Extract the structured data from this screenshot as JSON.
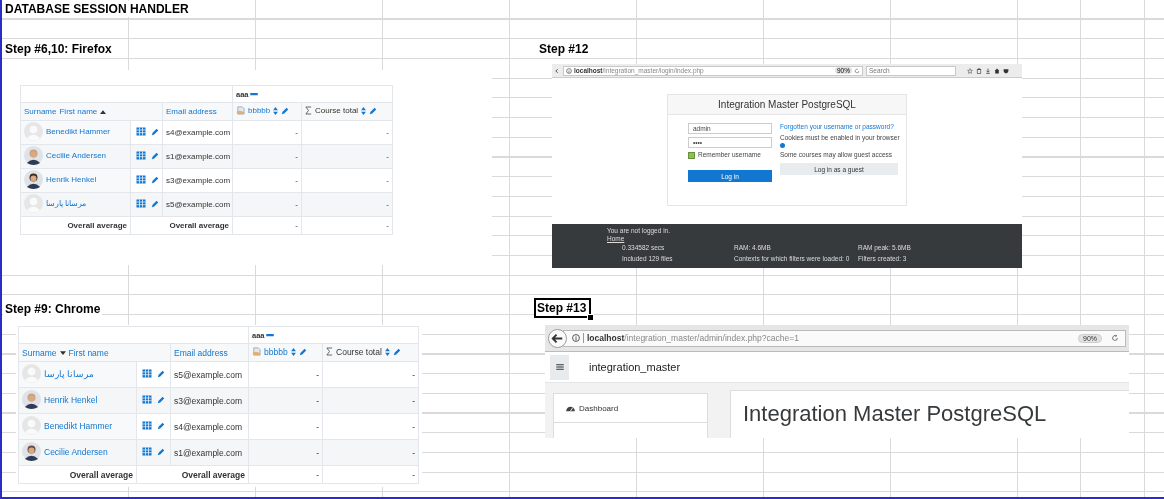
{
  "sheet_title": "DATABASE SESSION HANDLER",
  "sections": [
    {
      "kind": "grades",
      "heading": "Step #6,10: Firefox",
      "selected": false,
      "category": "aaa",
      "name_headers": [
        {
          "label": "Surname",
          "sorted": false
        },
        {
          "label": "First name",
          "sorted": true,
          "descending": false
        }
      ],
      "email_header": "Email address",
      "grade_item": "bbbbb",
      "total_header": "Course total",
      "rows": [
        {
          "name": "Benedikt Hammer",
          "has_photo": false,
          "email": "s4@example.com",
          "grade": "-",
          "total": "-"
        },
        {
          "name": "Cecilie Andersen",
          "has_photo": true,
          "email": "s1@example.com",
          "grade": "-",
          "total": "-"
        },
        {
          "name": "Henrik Henkel",
          "has_photo": true,
          "email": "s3@example.com",
          "grade": "-",
          "total": "-"
        },
        {
          "name": "مرسانا پارسا",
          "has_photo": false,
          "email": "s5@example.com",
          "grade": "-",
          "total": "-"
        }
      ],
      "average": {
        "label_1": "Overall average",
        "label_2": "Overall average",
        "grade": "-",
        "total": "-"
      }
    },
    {
      "kind": "login",
      "heading": "Step #12",
      "selected": false,
      "url_host": "localhost",
      "url_path": "/integration_master/login/index.php",
      "zoom": "90%",
      "search_placeholder": "Search",
      "site_title": "Integration Master PostgreSQL",
      "username": "admin",
      "password": "••••",
      "remember": {
        "label": "Remember username",
        "checked": true
      },
      "forgot_link": "Forgotten your username or password?",
      "cookies_note": "Cookies must be enabled in your browser",
      "guest_note": "Some courses may allow guest access",
      "guest_button": "Log in as a guest",
      "login_button": "Log in",
      "footer": {
        "status": "You are not logged in.",
        "home_link": "Home",
        "stats": [
          "0.334582 secs",
          "RAM: 4.6MB",
          "RAM peak: 5.6MB",
          "Included 129 files",
          "Contexts for which filters were loaded: 0",
          "Filters created: 3"
        ]
      }
    },
    {
      "kind": "grades",
      "heading": "Step #9: Chrome",
      "selected": false,
      "category": "aaa",
      "name_headers": [
        {
          "label": "Surname",
          "sorted": true,
          "descending": true
        },
        {
          "label": "First name",
          "sorted": false
        }
      ],
      "email_header": "Email address",
      "grade_item": "bbbbb",
      "total_header": "Course total",
      "rows": [
        {
          "name": "مرسانا پارسا",
          "has_photo": false,
          "email": "s5@example.com",
          "grade": "-",
          "total": "-"
        },
        {
          "name": "Henrik Henkel",
          "has_photo": true,
          "email": "s3@example.com",
          "grade": "-",
          "total": "-"
        },
        {
          "name": "Benedikt Hammer",
          "has_photo": false,
          "email": "s4@example.com",
          "grade": "-",
          "total": "-"
        },
        {
          "name": "Cecilie Andersen",
          "has_photo": true,
          "email": "s1@example.com",
          "grade": "-",
          "total": "-"
        }
      ],
      "average": {
        "label_1": "Overall average",
        "label_2": "Overall average",
        "grade": "-",
        "total": "-"
      }
    },
    {
      "kind": "admin",
      "heading": "Step #13",
      "selected": true,
      "url_host": "localhost",
      "url_path": "/integration_master/admin/index.php?cache=1",
      "zoom": "90%",
      "site_name": "integration_master",
      "nav_items": [
        {
          "label": "Dashboard"
        }
      ],
      "page_heading": "Integration Master PostgreSQL"
    }
  ]
}
